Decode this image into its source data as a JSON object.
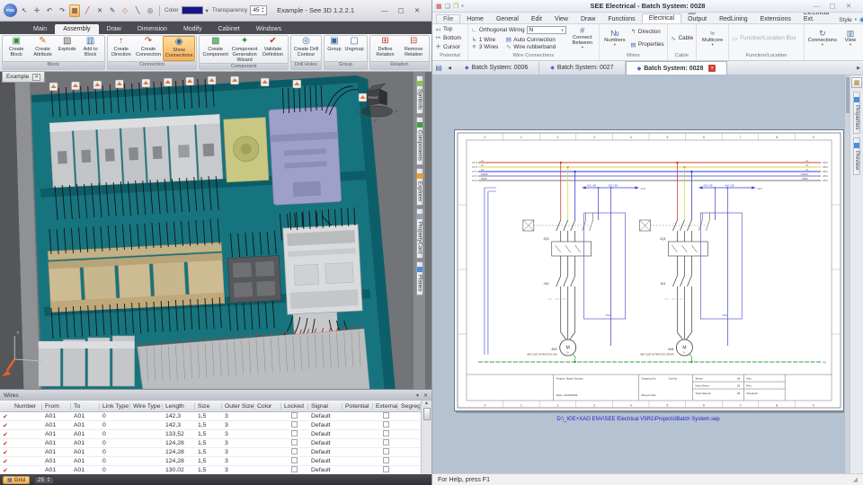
{
  "left_app": {
    "title": "Example - See 3D 1.2.2.1",
    "logo_text": "P3D",
    "qat": {
      "icons": [
        {
          "name": "select-icon",
          "glyph": "↖"
        },
        {
          "name": "move-icon",
          "glyph": "✛"
        },
        {
          "name": "undo-icon",
          "glyph": "↶"
        },
        {
          "name": "redo-icon",
          "glyph": "↷"
        },
        {
          "name": "grid-icon",
          "glyph": "▦"
        },
        {
          "name": "line-icon",
          "glyph": "╱"
        },
        {
          "name": "delete-icon",
          "glyph": "✕"
        },
        {
          "name": "pen-icon",
          "glyph": "✎"
        },
        {
          "name": "snap-point-icon",
          "glyph": "◇"
        },
        {
          "name": "measure-icon",
          "glyph": "╲"
        },
        {
          "name": "compass-icon",
          "glyph": "◎"
        }
      ],
      "color_label": "Color",
      "color_swatch_style": "background:#14148c;",
      "dropdown_glyph": "▾",
      "transparency_label": "Transparency",
      "transparency_value": "45",
      "spin_up": "▲",
      "spin_down": "▼"
    },
    "window_buttons": {
      "min": "—",
      "max": "▢",
      "close": "✕"
    },
    "tabs": [
      "Main",
      "Assembly",
      "Draw",
      "Dimension",
      "Modify",
      "Cabinet",
      "Windows"
    ],
    "ribbon": {
      "groups": [
        {
          "label": "Block",
          "buttons": [
            {
              "label": "Create Block",
              "glyph": "▣"
            },
            {
              "label": "Create Attribute",
              "glyph": "✎"
            },
            {
              "label": "Explode",
              "glyph": "▨"
            },
            {
              "label": "Add to Block",
              "glyph": "▥"
            }
          ]
        },
        {
          "label": "Connection",
          "buttons": [
            {
              "label": "Create Direction",
              "glyph": "↑"
            },
            {
              "label": "Create Connection",
              "glyph": "↷"
            },
            {
              "label": "Show Connections",
              "glyph": "◉"
            }
          ]
        },
        {
          "label": "Component",
          "buttons": [
            {
              "label": "Create Component",
              "glyph": "▩"
            },
            {
              "label": "Component Generation Wizard",
              "glyph": "✦"
            },
            {
              "label": "Validate Definition",
              "glyph": "✔"
            }
          ]
        },
        {
          "label": "Drill Holes",
          "buttons": [
            {
              "label": "Create Drill Contour",
              "glyph": "◎"
            }
          ]
        },
        {
          "label": "Group",
          "buttons": [
            {
              "label": "Group",
              "glyph": "▣"
            },
            {
              "label": "Ungroup",
              "glyph": "▢"
            }
          ]
        },
        {
          "label": "Relation",
          "buttons": [
            {
              "label": "Define Relation",
              "glyph": "⊞"
            },
            {
              "label": "Remove Relation",
              "glyph": "⊟"
            }
          ]
        }
      ]
    },
    "viewport": {
      "doc_tab": "Example",
      "doc_tab_close": "✕",
      "viewcube_label": "FRONT",
      "compass": {
        "n": "N",
        "e": "E",
        "s": "S"
      },
      "axes": {
        "x": "X",
        "y": "Y"
      }
    },
    "side_tabs": [
      "Symbols",
      "Components",
      "Explorer",
      "PropertyCard",
      "Planes"
    ],
    "wires_panel": {
      "title": "Wires",
      "pin_glyph": "▾",
      "close_glyph": "✕",
      "check_glyph": "✔",
      "scroll_up": "▲",
      "scroll_down": "▼",
      "columns": [
        "Number",
        "From",
        "To",
        "Link Type",
        "Wire Type",
        "Length",
        "Size",
        "Outer Size",
        "Color",
        "Locked",
        "Signal",
        "Potential",
        "External",
        "Segregatio..."
      ],
      "rows": [
        {
          "from": "A01",
          "to": "A01",
          "link_type": "0",
          "length": "142,3",
          "size": "1,5",
          "outer_size": "3",
          "signal": "Default"
        },
        {
          "from": "A01",
          "to": "A01",
          "link_type": "0",
          "length": "142,3",
          "size": "1,5",
          "outer_size": "3",
          "signal": "Default"
        },
        {
          "from": "A01",
          "to": "A01",
          "link_type": "0",
          "length": "133,52",
          "size": "1,5",
          "outer_size": "3",
          "signal": "Default"
        },
        {
          "from": "A01",
          "to": "A01",
          "link_type": "0",
          "length": "124,28",
          "size": "1,5",
          "outer_size": "3",
          "signal": "Default"
        },
        {
          "from": "A01",
          "to": "A01",
          "link_type": "0",
          "length": "124,28",
          "size": "1,5",
          "outer_size": "3",
          "signal": "Default"
        },
        {
          "from": "A01",
          "to": "A01",
          "link_type": "0",
          "length": "124,28",
          "size": "1,5",
          "outer_size": "3",
          "signal": "Default"
        },
        {
          "from": "A01",
          "to": "A01",
          "link_type": "0",
          "length": "130,02",
          "size": "1,5",
          "outer_size": "3",
          "signal": "Default"
        }
      ]
    },
    "statusbar": {
      "grid_icon": "▦",
      "grid_label": "Grid",
      "spin_value": "25",
      "spin_up": "▲",
      "spin_down": "▼"
    }
  },
  "right_app": {
    "title": "SEE Electrical - Batch System: 0028",
    "title_icons": [
      {
        "name": "app-icon",
        "glyph": "▦"
      },
      {
        "name": "new-file-icon",
        "glyph": "❏"
      },
      {
        "name": "open-file-icon",
        "glyph": "❐"
      },
      {
        "name": "dropdown-icon",
        "glyph": "▾"
      }
    ],
    "window_buttons": {
      "min": "—",
      "max": "▢",
      "close": "✕"
    },
    "tabs": [
      "File",
      "Home",
      "General",
      "Edit",
      "View",
      "Draw",
      "Functions",
      "Electrical",
      "3D Output",
      "RedLining",
      "Extensions",
      "Electrical Ext."
    ],
    "style_label": "Style",
    "style_caret": "▾",
    "help_glyph": "◉",
    "info_glyph": "◉",
    "ribbon": {
      "potential": {
        "label": "Potential",
        "top": "Top",
        "bottom": "Bottom",
        "cursor": "Cursor",
        "top_icon": "↤",
        "bottom_icon": "↦",
        "cursor_icon": "✛"
      },
      "wire_connections": {
        "label": "Wire Connections",
        "orthogonal": "Orthogonal Wiring",
        "orthogonal_icon": "∟",
        "combo_value": "N",
        "combo_caret": "▾",
        "one_wire": "1 Wire",
        "one_wire_icon": "↳",
        "three_wires": "3 Wires",
        "three_wires_icon": "≡",
        "auto": "Auto Connection",
        "auto_icon": "▤",
        "rubberband": "Wire rubberband",
        "rubberband_icon": "∿",
        "connect_between": "Connect Between",
        "connect_icon": "#",
        "caret": "▾"
      },
      "wires": {
        "label": "Wires",
        "numbers": "Numbers",
        "numbers_icon": "№",
        "direction": "Direction",
        "direction_icon": "↰",
        "properties": "Properties",
        "properties_icon": "▤",
        "caret": "▾"
      },
      "cable": {
        "label": "Cable",
        "cable": "Cable",
        "cable_icon": "∿"
      },
      "multicore": {
        "label": "Multicore",
        "icon": "≈",
        "caret": "▾"
      },
      "function_location": {
        "label": "Function/Location",
        "box": "Function/Location Box",
        "box_icon": "▭"
      },
      "connections": {
        "label": "Connections",
        "icon": "↻",
        "caret": "▾"
      },
      "view": {
        "label": "View",
        "icon": "▥",
        "caret": "▾"
      }
    },
    "docbar": {
      "pages_icon": "▤",
      "nav_left": "◀",
      "nav_right": "▶",
      "diamond": "◆",
      "close_glyph": "✕",
      "tabs": [
        "Batch System: 0006",
        "Batch System: 0027",
        "Batch System: 0028"
      ]
    },
    "side_strip": {
      "toolbox_icon": "▦",
      "tabs": [
        "Properties",
        "Preview"
      ]
    },
    "statusbar": "For Help, press F1",
    "drawing": {
      "columns": [
        "0",
        "1",
        "2",
        "3",
        "4",
        "5",
        "6",
        "7",
        "8",
        "9"
      ],
      "wires": [
        {
          "name": "L1",
          "ref": "27.0",
          "ref_r": "28.0"
        },
        {
          "name": "L2",
          "ref": "27.0",
          "ref_r": "28.0"
        },
        {
          "name": "L3",
          "ref": "27.0",
          "ref_r": "28.0"
        },
        {
          "name": "24VDC",
          "ref": "27.0",
          "ref_r": "28.0"
        },
        {
          "name": "0VDC",
          "ref": "27.0",
          "ref_r": "28.0"
        }
      ],
      "pe_label": "PE",
      "circuits": [
        {
          "breaker": "-3Q2",
          "contactor": "-3K2",
          "motor": "-3M2",
          "motor_letter": "M",
          "motor_phase": "3~",
          "desc": "WET DUST EXTRACTOR, FAN",
          "wire_tag": "A02 1.5B",
          "ref": "13.8",
          "box": "3W1"
        },
        {
          "breaker": "-3Q4",
          "contactor": "-3K4",
          "motor": "-3M4",
          "motor_letter": "M",
          "motor_phase": "3~",
          "desc": "WET DUST EXTRACTOR, DRYER",
          "wire_tag": "A04 1.5B",
          "ref": "13.8",
          "box": "3W2"
        }
      ],
      "title_block": {
        "project": "Project: Batch System",
        "dot": ".",
        "date": "Date: 10/28/2009",
        "drawing_no": "Drawing No",
        "job_no": "Job No",
        "sheet_index": "Sheet Index",
        "sheet_index_val": ".",
        "sheet": "Sheet:",
        "sheet_val": "28",
        "next_sheet": "Next Sheet:",
        "next_val": "29",
        "total": "Total Sheets:",
        "total_val": "28",
        "info": "Info:",
        "info_val": ".",
        "rev": "Rev.:",
        "rev_val": ".",
        "checked": "Checked:",
        "checked_val": "."
      },
      "path_text": "D:\\_IGE+XAO ENV\\SEE Electrical V5R1\\Projects\\Batch System.sep"
    }
  },
  "colors": {
    "cabinet_teal": "#16747e",
    "highlight_orange": "#f7b05a",
    "wire_l1": "#cf3f36",
    "wire_l2": "#e4d44a",
    "wire_l3": "#3a3ac8",
    "wire_pe": "#2da03c",
    "close_red": "#cc4438"
  }
}
